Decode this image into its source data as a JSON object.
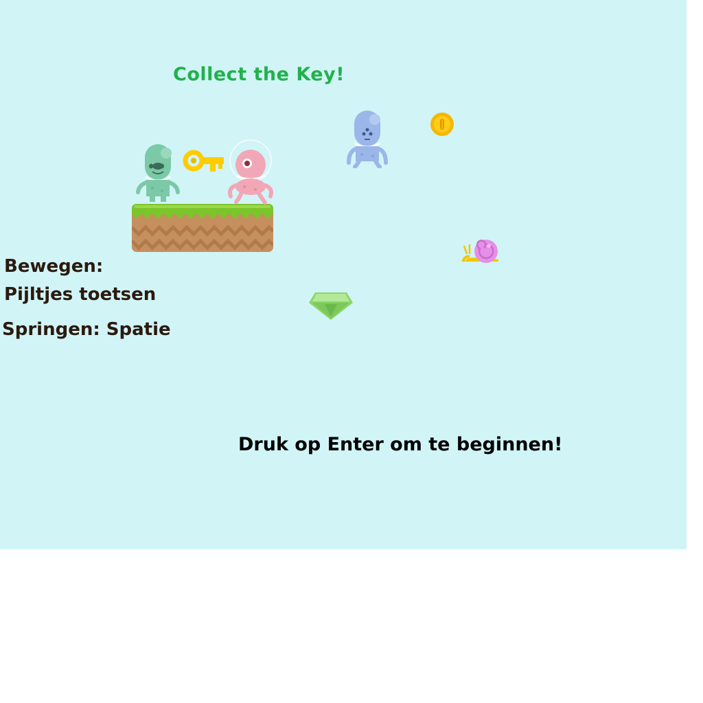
{
  "game": {
    "title": "Collect the Key!",
    "controls": {
      "move_label": "Bewegen:",
      "move_keys": "Pijltjes toetsen",
      "jump": "Springen: Spatie"
    },
    "start_prompt": "Druk op Enter om te beginnen!"
  },
  "sprites": [
    {
      "name": "green-alien-player",
      "icon": "green-alien"
    },
    {
      "name": "golden-key",
      "icon": "key"
    },
    {
      "name": "pink-alien",
      "icon": "pink-cyclops-alien"
    },
    {
      "name": "blue-alien",
      "icon": "blue-alien"
    },
    {
      "name": "gold-coin",
      "icon": "coin"
    },
    {
      "name": "snail-enemy",
      "icon": "snail"
    },
    {
      "name": "green-gem",
      "icon": "gem"
    },
    {
      "name": "grass-platform",
      "icon": "grass-dirt-block"
    }
  ],
  "colors": {
    "sky": "#d1f4f7",
    "title": "#22b14c",
    "instructions": "#2b1a0e",
    "prompt": "#000000",
    "grass": "#7cc52b",
    "dirt": "#c58f5e",
    "key": "#ffcc00",
    "coin": "#f5b800"
  }
}
